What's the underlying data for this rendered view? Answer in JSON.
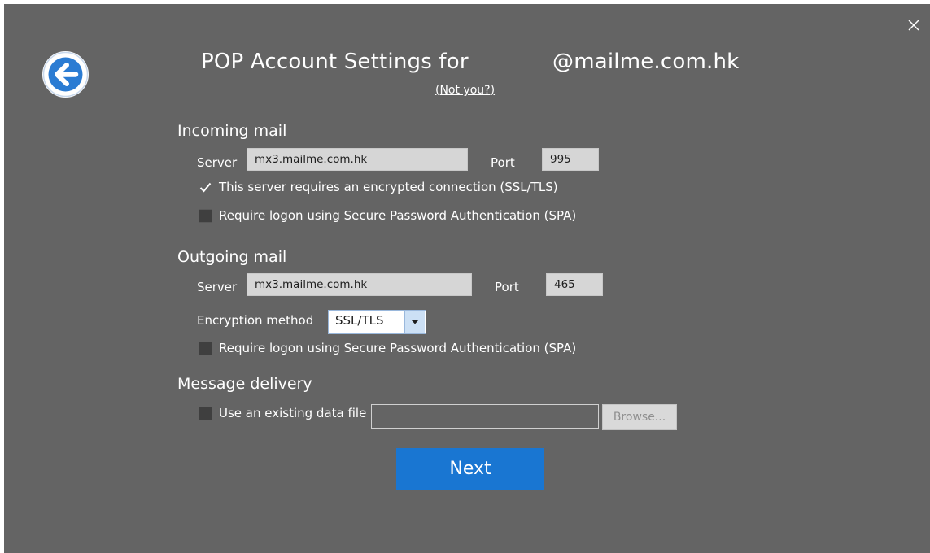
{
  "header": {
    "title_prefix": "POP Account Settings for",
    "title_email": "@mailme.com.hk",
    "not_you_link": "(Not you?)"
  },
  "incoming": {
    "heading": "Incoming mail",
    "server_label": "Server",
    "server_value": "mx3.mailme.com.hk",
    "port_label": "Port",
    "port_value": "995",
    "ssl_checkbox": {
      "label": "This server requires an encrypted connection (SSL/TLS)",
      "checked": true
    },
    "spa_checkbox": {
      "label": "Require logon using Secure Password Authentication (SPA)",
      "checked": false
    }
  },
  "outgoing": {
    "heading": "Outgoing mail",
    "server_label": "Server",
    "server_value": "mx3.mailme.com.hk",
    "port_label": "Port",
    "port_value": "465",
    "encryption_label": "Encryption method",
    "encryption_value": "SSL/TLS",
    "spa_checkbox": {
      "label": "Require logon using Secure Password Authentication (SPA)",
      "checked": false
    }
  },
  "delivery": {
    "heading": "Message delivery",
    "data_file_checkbox": {
      "label": "Use an existing data file",
      "checked": false
    },
    "file_path_value": "",
    "browse_label": "Browse..."
  },
  "next_label": "Next",
  "colors": {
    "dialog_bg": "#646464",
    "accent": "#1976d2",
    "back_arrow": "#2b7cd3"
  },
  "icons": {
    "back": "back-arrow-icon",
    "close": "close-icon",
    "dropdown": "chevron-down-icon",
    "check": "checkmark-icon"
  }
}
